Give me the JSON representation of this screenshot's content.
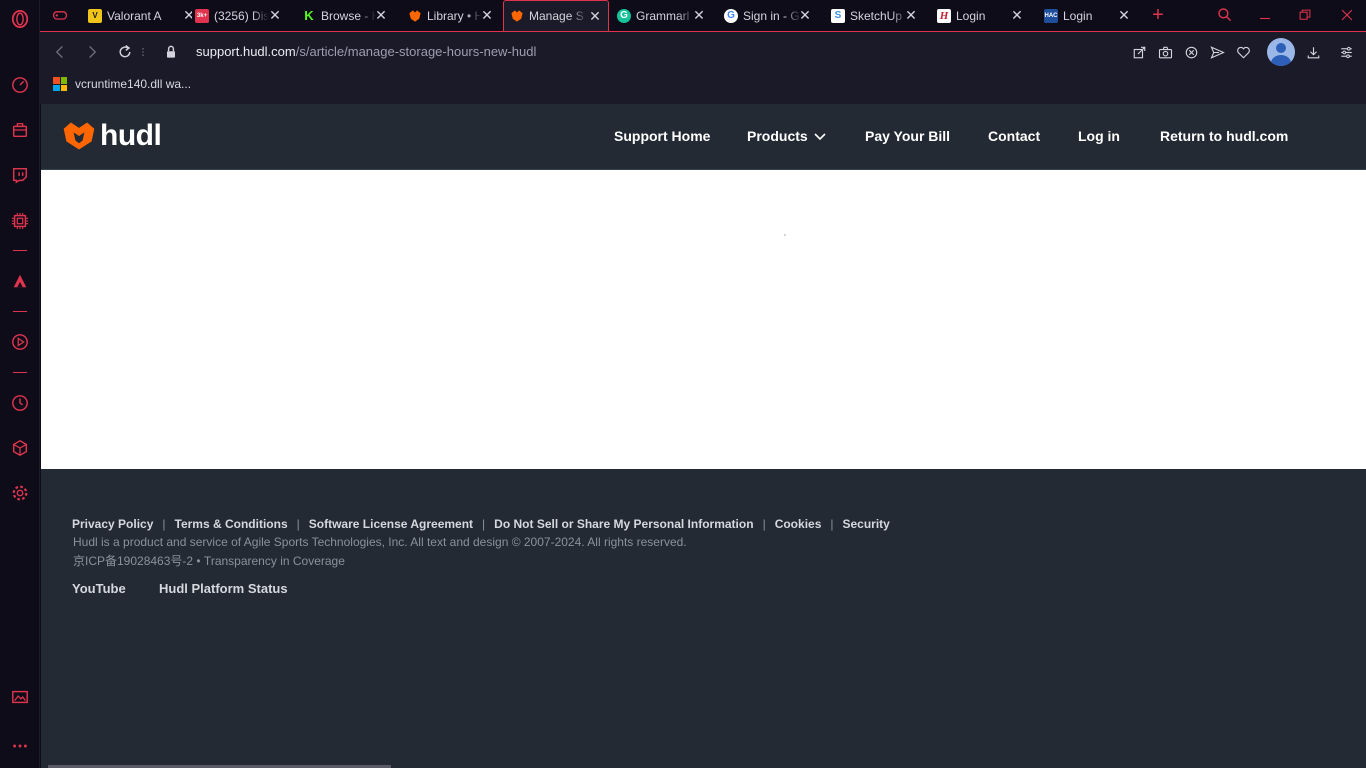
{
  "browser": {
    "tabs": [
      {
        "label": "Valorant A",
        "favicon_color": "#f0c419",
        "favicon_text": "V"
      },
      {
        "label": "(3256) Dis",
        "favicon_color": "#e0344e",
        "favicon_text": "3k+"
      },
      {
        "label": "Browse - K",
        "favicon_color": "#53fc18",
        "favicon_text": "K"
      },
      {
        "label": "Library • H",
        "favicon_color": "#ff6600",
        "favicon_text": ""
      },
      {
        "label": "Manage S",
        "favicon_color": "#ff6600",
        "favicon_text": ""
      },
      {
        "label": "Grammarl",
        "favicon_color": "#15c39a",
        "favicon_text": "G"
      },
      {
        "label": "Sign in - G",
        "favicon_color": "#ffffff",
        "favicon_text": "G"
      },
      {
        "label": "SketchUp",
        "favicon_color": "#3c8ede",
        "favicon_text": "S"
      },
      {
        "label": "Login",
        "favicon_color": "#ffffff",
        "favicon_text": "H"
      },
      {
        "label": "Login",
        "favicon_color": "#1f4e9a",
        "favicon_text": "HAC"
      }
    ],
    "address": {
      "host": "support.hudl.com",
      "path": "/s/article/manage-storage-hours-new-hudl"
    },
    "bookmarks": [
      {
        "label": "vcruntime140.dll wa..."
      }
    ],
    "accent_color": "#e0344e"
  },
  "hudl": {
    "logo_text": "hudl",
    "nav": {
      "support_home": "Support Home",
      "products": "Products",
      "pay_bill": "Pay Your Bill",
      "contact": "Contact",
      "log_in": "Log in",
      "return": "Return to hudl.com"
    },
    "footer": {
      "links": [
        "Privacy Policy",
        "Terms & Conditions",
        "Software License Agreement",
        "Do Not Sell or Share My Personal Information",
        "Cookies",
        "Security"
      ],
      "copyright": "Hudl is a product and service of Agile Sports Technologies, Inc. All text and design © 2007-2024. All rights reserved.",
      "icp": "京ICP备19028463号-2 • Transparency in Coverage",
      "social": [
        "YouTube",
        "Hudl Platform Status"
      ]
    },
    "brand_orange": "#ff6600",
    "header_bg": "#232a33"
  }
}
